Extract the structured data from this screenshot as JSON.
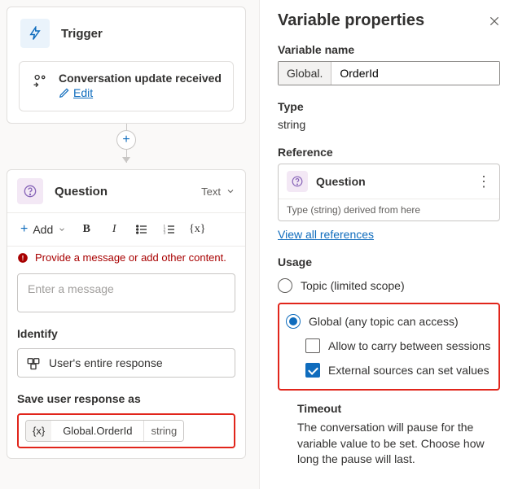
{
  "canvas": {
    "trigger": {
      "title": "Trigger",
      "body_title": "Conversation update received",
      "edit_label": "Edit"
    },
    "question": {
      "title": "Question",
      "type_label": "Text",
      "add_label": "Add",
      "warning": "Provide a message or add other content.",
      "message_placeholder": "Enter a message",
      "identify_label": "Identify",
      "identify_value": "User's entire response",
      "save_label": "Save user response as",
      "var_name": "Global.OrderId",
      "var_type": "string"
    }
  },
  "panel": {
    "title": "Variable properties",
    "varname_label": "Variable name",
    "varname_prefix": "Global.",
    "varname_value": "OrderId",
    "type_label": "Type",
    "type_value": "string",
    "reference_label": "Reference",
    "reference_title": "Question",
    "reference_sub": "Type (string) derived from here",
    "view_all": "View all references",
    "usage_label": "Usage",
    "usage_topic": "Topic (limited scope)",
    "usage_global": "Global (any topic can access)",
    "usage_carry": "Allow to carry between sessions",
    "usage_external": "External sources can set values",
    "timeout_label": "Timeout",
    "timeout_body": "The conversation will pause for the variable value to be set. Choose how long the pause will last."
  }
}
